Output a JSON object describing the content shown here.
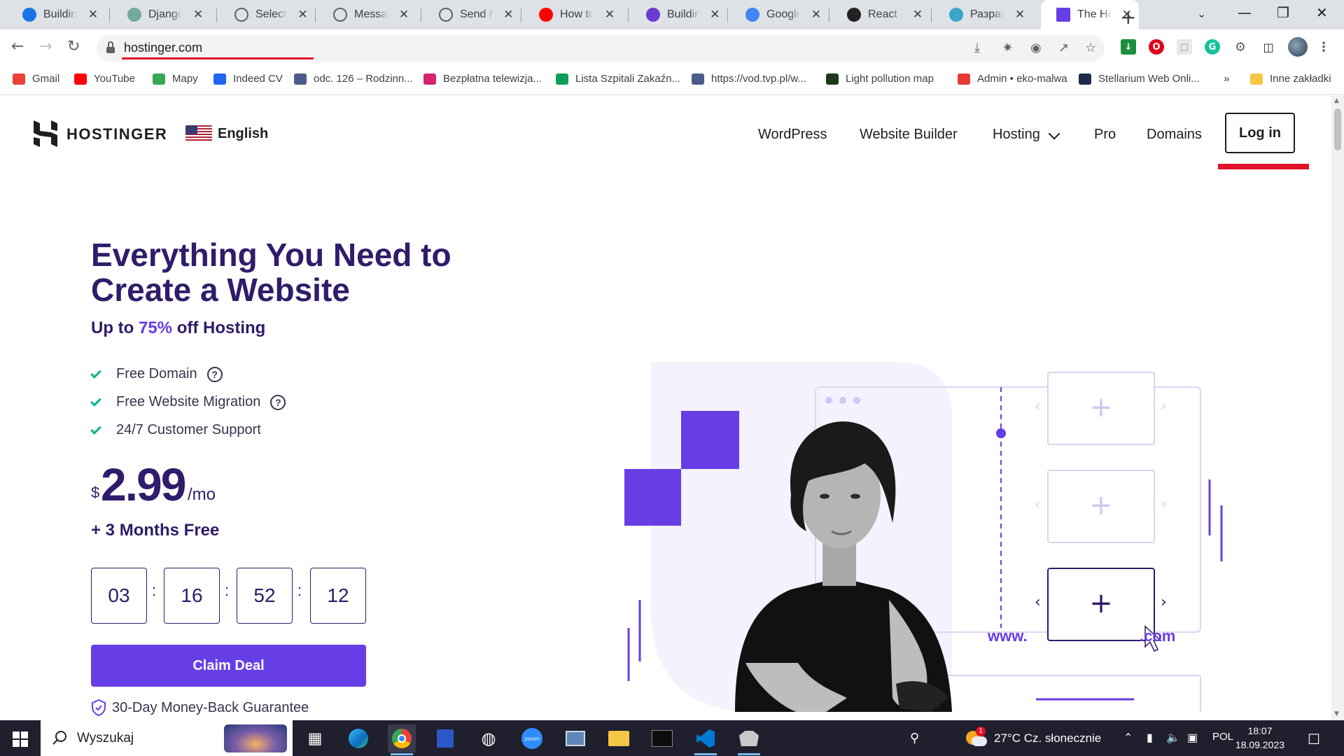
{
  "browser": {
    "tabs": [
      {
        "label": "Building C",
        "icon": "blue-dot-icon",
        "color": "#1a73e8"
      },
      {
        "label": "Django A",
        "icon": "openai-icon",
        "color": "#74aa9c"
      },
      {
        "label": "Select me",
        "icon": "globe-icon",
        "color": "#5f6368"
      },
      {
        "label": "Message",
        "icon": "globe-icon",
        "color": "#5f6368"
      },
      {
        "label": "Send Mes",
        "icon": "globe-icon",
        "color": "#5f6368"
      },
      {
        "label": "How to C",
        "icon": "youtube-icon",
        "color": "#ff0000"
      },
      {
        "label": "Building",
        "icon": "purple-a-icon",
        "color": "#6c3ad1"
      },
      {
        "label": "Google П",
        "icon": "google-translate-icon",
        "color": "#4285f4"
      },
      {
        "label": "React App",
        "icon": "react-icon",
        "color": "#222222"
      },
      {
        "label": "Разрабо",
        "icon": "cube-icon",
        "color": "#3ba4c9"
      },
      {
        "label": "The Host",
        "icon": "hostinger-icon",
        "color": "#673de6",
        "active": true
      }
    ],
    "url": "hostinger.com",
    "bookmarks": [
      {
        "label": "Gmail",
        "icon": "gmail-icon",
        "color": "#ea4335"
      },
      {
        "label": "YouTube",
        "icon": "youtube-icon",
        "color": "#ff0000"
      },
      {
        "label": "Mapy",
        "icon": "maps-icon",
        "color": "#34a853"
      },
      {
        "label": "Indeed CV",
        "icon": "indeed-icon",
        "color": "#2164f3"
      },
      {
        "label": "odc. 126 – Rodzinn...",
        "icon": "vod-icon",
        "color": "#4a5b8c"
      },
      {
        "label": "Bezpłatna telewizja...",
        "icon": "pilot-icon",
        "color": "#d6246e"
      },
      {
        "label": "Lista Szpitali Zakaźn...",
        "icon": "sheets-icon",
        "color": "#0f9d58"
      },
      {
        "label": "https://vod.tvp.pl/w...",
        "icon": "vod-icon",
        "color": "#4a5b8c"
      },
      {
        "label": "Light pollution map",
        "icon": "lightmap-icon",
        "color": "#1b3a1b"
      },
      {
        "label": "Admin • eko-malwa",
        "icon": "cart-icon",
        "color": "#e53935"
      },
      {
        "label": "Stellarium Web Onli...",
        "icon": "stellarium-icon",
        "color": "#1e2a4a"
      },
      {
        "label": "»",
        "icon": "",
        "color": ""
      },
      {
        "label": "Inne zakładki",
        "icon": "folder-icon",
        "color": "#f6c744"
      }
    ]
  },
  "site": {
    "logo": "HOSTINGER",
    "language": "English",
    "nav": [
      "WordPress",
      "Website Builder",
      "Hosting",
      "Pro",
      "Domains"
    ],
    "login": "Log in",
    "headline": "Everything You Need to Create a Website",
    "subhead_prefix": "Up to ",
    "subhead_accent": "75%",
    "subhead_suffix": " off Hosting",
    "features": [
      "Free Domain",
      "Free Website Migration",
      "24/7 Customer Support"
    ],
    "price_currency": "$",
    "price_amount": "2.99",
    "price_period": "/mo",
    "bonus": "+ 3 Months Free",
    "countdown": [
      "03",
      "16",
      "52",
      "12"
    ],
    "cta": "Claim Deal",
    "guarantee": "30-Day Money-Back Guarantee",
    "domain_prefix": "www.",
    "domain_suffix": ".com",
    "colors": {
      "brand": "#673de6",
      "heading": "#2f1c6a",
      "check": "#00b090",
      "annotation": "#e3132b"
    }
  },
  "taskbar": {
    "search_placeholder": "Wyszukaj",
    "weather": "27°C  Cz. słonecznie",
    "weather_badge": "1",
    "language": "POL",
    "time": "18:07",
    "date": "18.09.2023"
  }
}
